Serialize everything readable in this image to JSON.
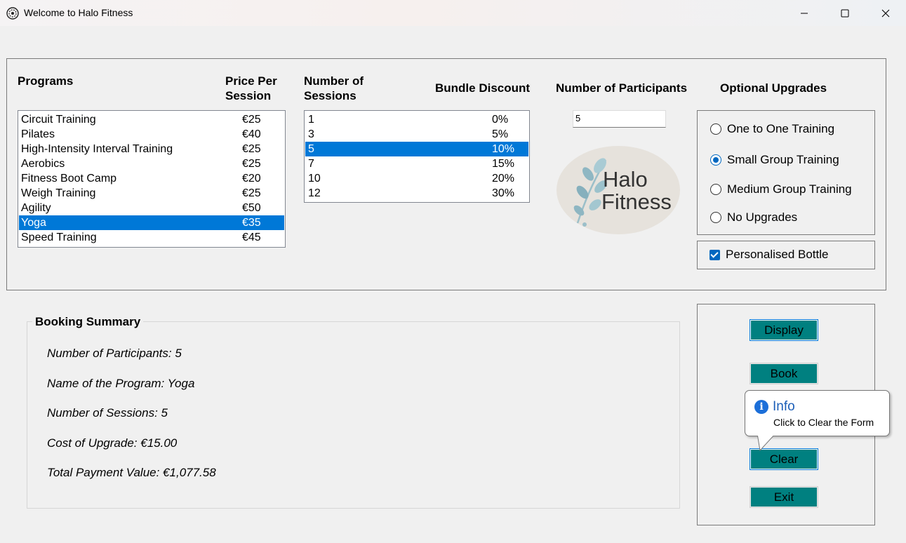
{
  "window": {
    "title": "Welcome to Halo Fitness",
    "app_icon": "halo-logo-icon",
    "controls": [
      "minimize-icon",
      "maximize-icon",
      "close-icon"
    ]
  },
  "headers": {
    "programs": "Programs",
    "price_line1": "Price Per",
    "price_line2": "Session",
    "sessions_line1": "Number of",
    "sessions_line2": "Sessions",
    "bundle_discount": "Bundle Discount",
    "participants": "Number of Participants",
    "upgrades": "Optional Upgrades"
  },
  "programs": [
    {
      "name": "Circuit Training",
      "price": "€25"
    },
    {
      "name": "Pilates",
      "price": "€40"
    },
    {
      "name": "High-Intensity Interval Training",
      "price": "€25"
    },
    {
      "name": "Aerobics",
      "price": "€25"
    },
    {
      "name": "Fitness Boot Camp",
      "price": "€20"
    },
    {
      "name": "Weigh Training",
      "price": "€25"
    },
    {
      "name": "Agility",
      "price": "€50"
    },
    {
      "name": "Yoga",
      "price": "€35"
    },
    {
      "name": "Speed Training",
      "price": "€45"
    }
  ],
  "programs_selected_index": 7,
  "sessions": [
    {
      "count": "1",
      "discount": "0%"
    },
    {
      "count": "3",
      "discount": "5%"
    },
    {
      "count": "5",
      "discount": "10%"
    },
    {
      "count": "7",
      "discount": "15%"
    },
    {
      "count": "10",
      "discount": "20%"
    },
    {
      "count": "12",
      "discount": "30%"
    }
  ],
  "sessions_selected_index": 2,
  "participants_value": "5",
  "logo": {
    "line1": "Halo",
    "line2": "Fitness"
  },
  "upgrades": [
    {
      "label": "One to One Training",
      "checked": false
    },
    {
      "label": "Small Group Training",
      "checked": true
    },
    {
      "label": "Medium Group Training",
      "checked": false
    },
    {
      "label": "No Upgrades",
      "checked": false
    }
  ],
  "bottle": {
    "label": "Personalised Bottle",
    "checked": true
  },
  "summary": {
    "legend": "Booking Summary",
    "lines": [
      "Number of Participants:  5",
      "Name of the Program:  Yoga",
      "Number of Sessions:  5",
      "Cost of Upgrade:  €15.00",
      "Total Payment Value:  €1,077.58"
    ]
  },
  "buttons": {
    "display": "Display",
    "book": "Book",
    "clear": "Clear",
    "exit": "Exit"
  },
  "tooltip": {
    "title": "Info",
    "text": "Click to Clear the Form",
    "icon": "info-icon"
  },
  "colors": {
    "selection": "#0078d7",
    "button": "#008080",
    "accent": "#0067c0"
  }
}
